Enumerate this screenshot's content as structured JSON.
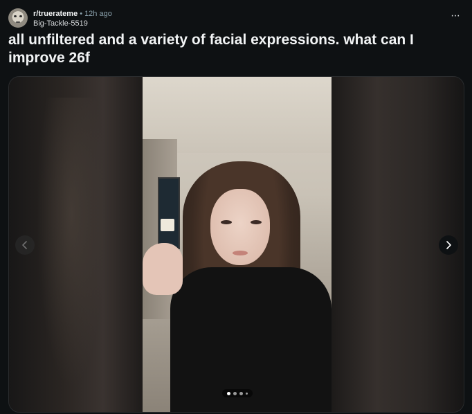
{
  "post": {
    "subreddit": "r/truerateme",
    "separator": "•",
    "time": "12h ago",
    "author": "Big-Tackle-5519",
    "more_label": "···",
    "title": "all unfiltered and a variety of facial expressions. what can I improve 26f"
  },
  "gallery": {
    "prev_icon": "chevron-left-icon",
    "next_icon": "chevron-right-icon",
    "dots": [
      {
        "active": true
      },
      {
        "active": false
      },
      {
        "active": false
      },
      {
        "active": false,
        "small": true
      }
    ],
    "current_index": 1
  },
  "colors": {
    "background": "#0e1113",
    "text": "#f2f4f5",
    "muted": "#8ba2ad"
  }
}
